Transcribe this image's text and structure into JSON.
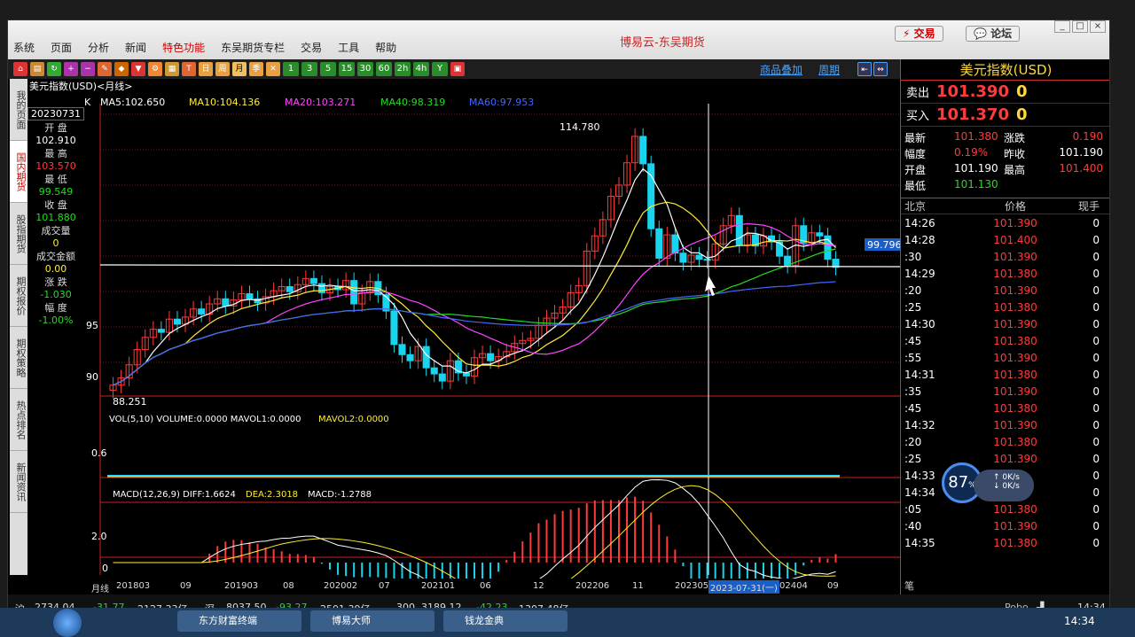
{
  "window": {
    "title": "博易云-东吴期货",
    "trade_button": "交易",
    "forum_button": "论坛",
    "controls": [
      "_",
      "□",
      "×"
    ]
  },
  "menu": [
    "系统",
    "页面",
    "分析",
    "新闻",
    "特色功能",
    "东吴期货专栏",
    "交易",
    "工具",
    "帮助"
  ],
  "toolbar": {
    "periods": [
      "1",
      "3",
      "5",
      "15",
      "30",
      "60",
      "2h",
      "4h",
      "Y"
    ],
    "link_overlay": "商品叠加",
    "link_period": "周期"
  },
  "left_nav": [
    "我的页面",
    "国内期货",
    "股指期货",
    "期权报价",
    "期权策略",
    "热点排名",
    "新闻资讯"
  ],
  "chart": {
    "instrument_label": "美元指数(USD)<月线>",
    "ma_line": {
      "k": "K",
      "ma5": "MA5:102.650",
      "ma10": "MA10:104.136",
      "ma20": "MA20:103.271",
      "ma40": "MA40:98.319",
      "ma60": "MA60:97.953"
    },
    "high_label": "114.780",
    "low_label": "88.251",
    "cursor_price": "99.796",
    "y_ticks": [
      "95",
      "90"
    ],
    "vol_label": "VOL(5,10) VOLUME:0.0000 MAVOL1:0.0000",
    "vol_label2": "MAVOL2:0.0000",
    "vol_tick": "0.6",
    "macd_label": "MACD(12,26,9) DIFF:1.6624",
    "macd_dea": "DEA:2.3018",
    "macd_val": "MACD:-1.2788",
    "macd_ticks": [
      "2.0",
      "0"
    ],
    "x_labels": [
      "月线",
      "201803",
      "09",
      "201903",
      "08",
      "202002",
      "07",
      "202101",
      "06",
      "12",
      "202206",
      "11",
      "202305",
      "2023-07-31(一)",
      "02404",
      "09"
    ]
  },
  "info_box": {
    "date": "20230731",
    "open_label": "开 盘",
    "open": "102.910",
    "high_label": "最 高",
    "high": "103.570",
    "low_label": "最 低",
    "low": "99.549",
    "close_label": "收 盘",
    "close": "101.880",
    "vol_label": "成交量",
    "vol": "0",
    "amount_label": "成交金额",
    "amount": "0.00",
    "chg_label": "涨 跌",
    "chg": "-1.030",
    "pct_label": "幅 度",
    "pct": "-1.00%"
  },
  "quote": {
    "title": "美元指数(USD)",
    "sell_label": "卖出",
    "sell": "101.390",
    "sell_qty": "0",
    "buy_label": "买入",
    "buy": "101.370",
    "buy_qty": "0",
    "last_label": "最新",
    "last": "101.380",
    "change_label": "涨跌",
    "change": "0.190",
    "range_label": "幅度",
    "range": "0.19%",
    "prev_label": "昨收",
    "prev": "101.190",
    "open_label": "开盘",
    "open": "101.190",
    "high_label": "最高",
    "high": "101.400",
    "low_label": "最低",
    "low": "101.130",
    "ticks_head": [
      "北京",
      "价格",
      "现手"
    ],
    "ticks": [
      [
        "14:26",
        "101.390",
        "0"
      ],
      [
        "14:28",
        "101.400",
        "0"
      ],
      [
        ":30",
        "101.390",
        "0"
      ],
      [
        "14:29",
        "101.380",
        "0"
      ],
      [
        ":20",
        "101.390",
        "0"
      ],
      [
        ":25",
        "101.380",
        "0"
      ],
      [
        "14:30",
        "101.390",
        "0"
      ],
      [
        ":45",
        "101.380",
        "0"
      ],
      [
        ":55",
        "101.390",
        "0"
      ],
      [
        "14:31",
        "101.380",
        "0"
      ],
      [
        ":35",
        "101.390",
        "0"
      ],
      [
        ":45",
        "101.380",
        "0"
      ],
      [
        "14:32",
        "101.390",
        "0"
      ],
      [
        ":20",
        "101.380",
        "0"
      ],
      [
        ":25",
        "101.390",
        "0"
      ],
      [
        "14:33",
        "",
        "0"
      ],
      [
        "14:34",
        "",
        "0"
      ],
      [
        ":05",
        "101.380",
        "0"
      ],
      [
        ":40",
        "101.390",
        "0"
      ],
      [
        "14:35",
        "101.380",
        "0"
      ]
    ],
    "footer": "笔"
  },
  "speed_widget": {
    "percent": "87",
    "unit": "%",
    "up": "0K/s",
    "down": "0K/s"
  },
  "status": {
    "sh": "沪",
    "sh_val": "2734.04",
    "sh_chg": "-31.77",
    "sh_amt": "2127.33亿",
    "sz": "深",
    "sz_val": "8037.50",
    "sz_chg": "-93.27",
    "sz_amt": "2501.39亿",
    "c3": "300",
    "c3_val": "3189.12",
    "c3_chg": "-42.23",
    "c3_amt": "1307.48亿",
    "brand": "Pobo",
    "time": "14:34"
  },
  "taskbar": {
    "items": [
      "东方财富终端",
      "博易大师",
      "钱龙金典"
    ],
    "time": "14:34"
  },
  "colors": {
    "up": "#ff3b3b",
    "down": "#18d4ef",
    "ma5": "#ffffff",
    "ma10": "#ffee33",
    "ma20": "#ff44ff",
    "ma40": "#22dd22",
    "ma60": "#4466ff"
  }
}
